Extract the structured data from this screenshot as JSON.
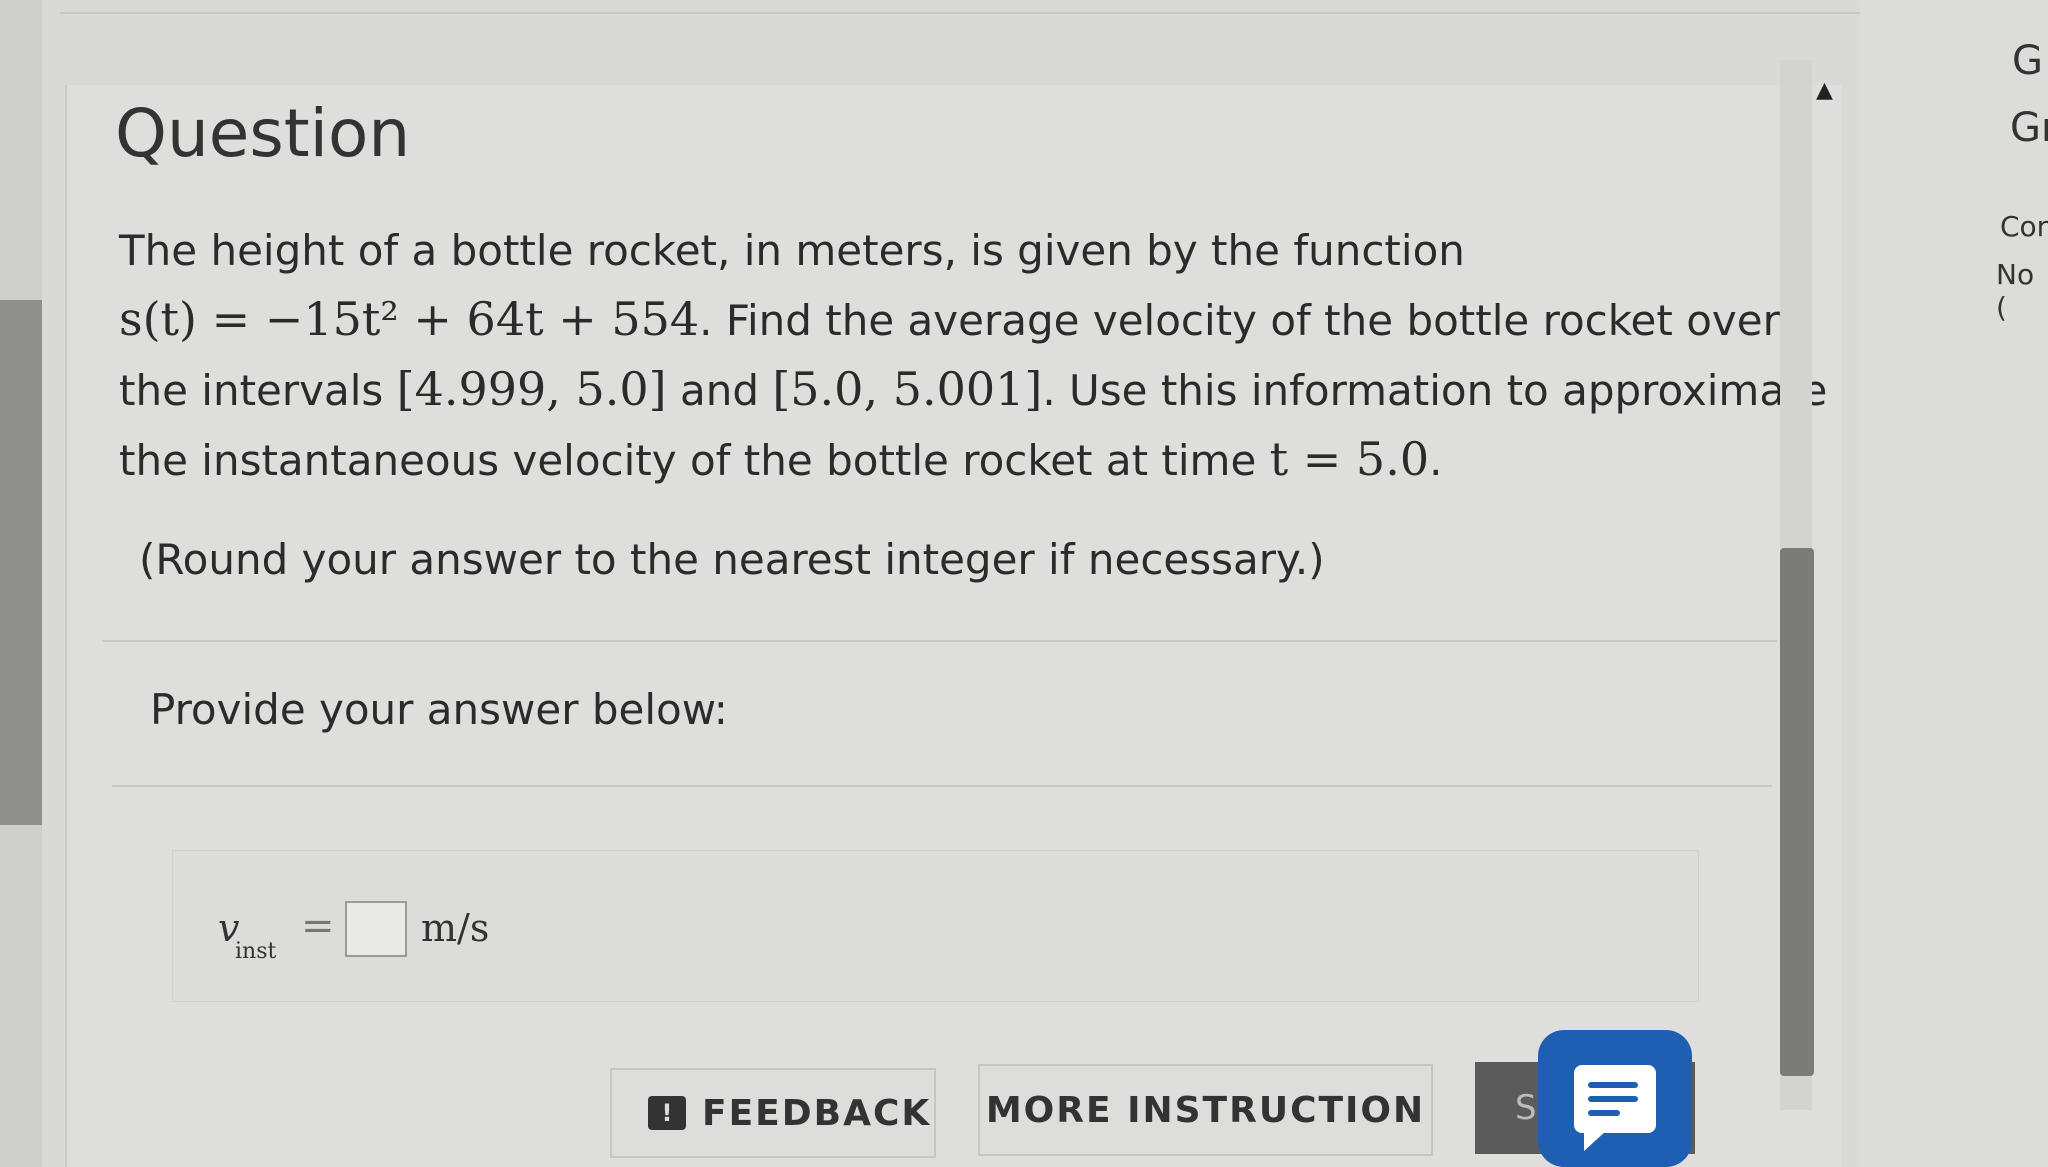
{
  "question": {
    "title": "Question",
    "prompt_lines": [
      {
        "text": "The height of a bottle rocket, in meters, is given by the function"
      },
      {
        "math1": "s(t) = −15t² + 64t + 554",
        "text": ". Find the average velocity of the bottle rocket over"
      },
      {
        "text1": "the intervals ",
        "math1": "[4.999, 5.0]",
        "text2": " and ",
        "math2": "[5.0, 5.001]",
        "text3": ". Use this information to approximate"
      },
      {
        "text1": "the instantaneous velocity of the bottle rocket at time ",
        "math1": "t = 5.0",
        "text2": "."
      }
    ],
    "round_note": "(Round your answer to the nearest integer if necessary.)"
  },
  "answer": {
    "heading": "Provide your answer below:",
    "variable": "v",
    "subscript": "inst",
    "equals": "=",
    "value": "",
    "unit": "m/s"
  },
  "buttons": {
    "feedback": "FEEDBACK",
    "feedback_icon": "!",
    "more_instruction": "MORE INSTRUCTION",
    "submit_partial": "S"
  },
  "side_panel": {
    "g1": "G",
    "g2": "Gr",
    "con": "Con",
    "no": "No ("
  },
  "icons": {
    "chat": "chat-icon",
    "feedback": "feedback-icon",
    "scroll_up": "scroll-up-icon"
  },
  "colors": {
    "chat_button": "#1e5fb3",
    "submit_button": "#5b5b5b"
  }
}
